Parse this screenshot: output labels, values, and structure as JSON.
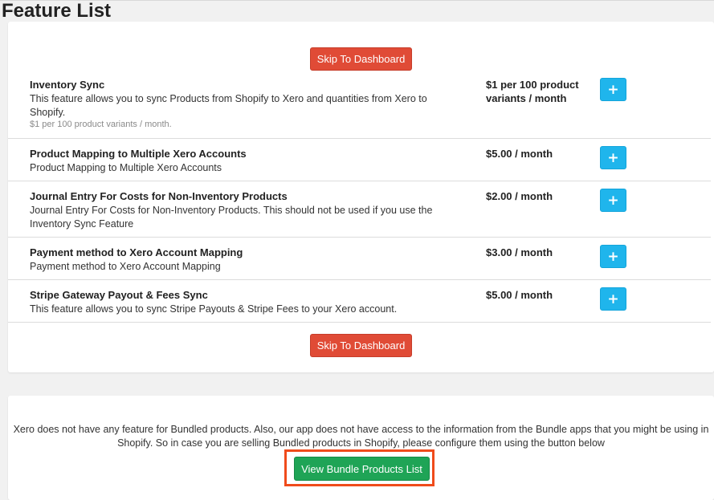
{
  "page_title": "Feature List",
  "skip_label": "Skip To Dashboard",
  "add_label": "+",
  "features": [
    {
      "name": "Inventory Sync",
      "description": "This feature allows you to sync Products from Shopify to Xero and quantities from Xero to Shopify.",
      "note": "$1 per 100 product variants / month.",
      "price": "$1 per 100 product variants / month"
    },
    {
      "name": "Product Mapping to Multiple Xero Accounts",
      "description": "Product Mapping to Multiple Xero Accounts",
      "price": "$5.00 / month"
    },
    {
      "name": "Journal Entry For Costs for Non-Inventory Products",
      "description": "Journal Entry For Costs for Non-Inventory Products. This should not be used if you use the Inventory Sync Feature",
      "price": "$2.00 / month"
    },
    {
      "name": "Payment method to Xero Account Mapping",
      "description": "Payment method to Xero Account Mapping",
      "price": "$3.00 / month"
    },
    {
      "name": "Stripe Gateway Payout & Fees Sync",
      "description": "This feature allows you to sync Stripe Payouts & Stripe Fees to your Xero account.",
      "price": "$5.00 / month"
    }
  ],
  "bundle": {
    "message": "Xero does not have any feature for Bundled products. Also, our app does not have access to the information from the Bundle apps that you might be using in Shopify. So in case you are selling Bundled products in Shopify, please configure them using the button below",
    "button_label": "View Bundle Products List"
  },
  "colors": {
    "skip_button": "#e04b36",
    "add_button": "#1fb5ec",
    "bundle_button": "#1fa456",
    "highlight_border": "#f04b1b"
  }
}
